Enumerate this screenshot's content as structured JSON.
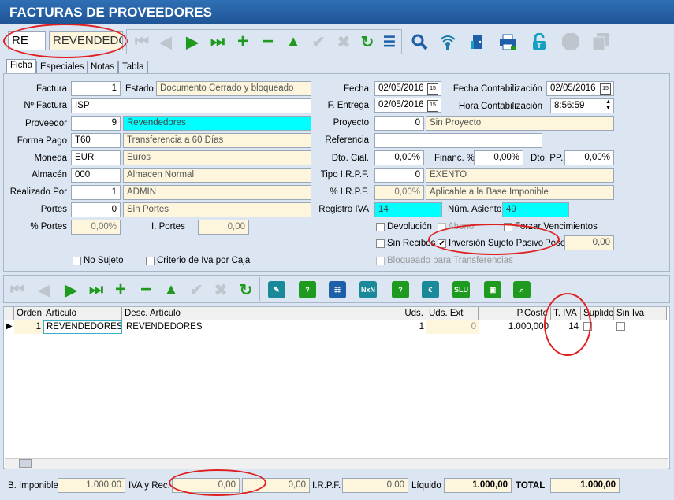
{
  "window": {
    "title": "FACTURAS DE PROVEEDORES"
  },
  "search": {
    "code": "RE",
    "name": "REVENDEDO"
  },
  "tabs": [
    "Ficha",
    "Especiales",
    "Notas",
    "Tabla"
  ],
  "form": {
    "factura_label": "Factura",
    "factura": "1",
    "estado_label": "Estado",
    "estado": "Documento Cerrado y bloqueado",
    "n_factura_label": "Nº Factura",
    "n_factura": "ISP",
    "proveedor_label": "Proveedor",
    "proveedor_code": "9",
    "proveedor_name": "Revendedores",
    "forma_pago_label": "Forma Pago",
    "forma_pago_code": "T60",
    "forma_pago_name": "Transferencia a 60 Días",
    "moneda_label": "Moneda",
    "moneda_code": "EUR",
    "moneda_name": "Euros",
    "almacen_label": "Almacén",
    "almacen_code": "000",
    "almacen_name": "Almacen Normal",
    "realizado_label": "Realizado Por",
    "realizado_code": "1",
    "realizado_name": "ADMIN",
    "portes_label": "Portes",
    "portes_code": "0",
    "portes_name": "Sin Portes",
    "pct_portes_label": "% Portes",
    "pct_portes": "0,00%",
    "i_portes_label": "I. Portes",
    "i_portes": "0,00",
    "fecha_label": "Fecha",
    "fecha": "02/05/2016",
    "fecha_cont_label": "Fecha Contabilización",
    "fecha_cont": "02/05/2016",
    "f_entrega_label": "F. Entrega",
    "f_entrega": "02/05/2016",
    "hora_cont_label": "Hora Contabilización",
    "hora_cont": "8:56:59",
    "proyecto_label": "Proyecto",
    "proyecto_code": "0",
    "proyecto_name": "Sin Proyecto",
    "referencia_label": "Referencia",
    "referencia": "",
    "dto_cial_label": "Dto. Cial.",
    "dto_cial": "0,00%",
    "financ_label": "Financ. %",
    "financ": "0,00%",
    "dto_pp_label": "Dto. PP.",
    "dto_pp": "0,00%",
    "tipo_irpf_label": "Tipo I.R.P.F.",
    "tipo_irpf_code": "0",
    "tipo_irpf_name": "EXENTO",
    "pct_irpf_label": "% I.R.P.F.",
    "pct_irpf": "0,00%",
    "pct_irpf_desc": "Aplicable a la Base Imponible",
    "registro_iva_label": "Registro IVA",
    "registro_iva": "14",
    "num_asiento_label": "Núm. Asiento",
    "num_asiento": "49",
    "devolucion_label": "Devolución",
    "abono_label": "Abono",
    "forzar_label": "Forzar Vencimientos",
    "sin_recibos_label": "Sin Recibos",
    "isp_label": "Inversión Sujeto Pasivo",
    "peso_label": "Peso",
    "peso": "0,00",
    "no_sujeto_label": "No Sujeto",
    "criterio_iva_label": "Criterio de Iva por Caja",
    "bloqueado_label": "Bloqueado para Transferencias"
  },
  "grid": {
    "headers": [
      "Orden",
      "Artículo",
      "Desc. Artículo",
      "Uds.",
      "Uds. Ext",
      "P.Coste",
      "T. IVA",
      "Suplido",
      "Sin Iva"
    ],
    "rows": [
      {
        "orden": "1",
        "articulo": "REVENDEDORES",
        "desc": "REVENDEDORES",
        "uds": "1",
        "uds_ext": "0",
        "p_coste": "1.000,000",
        "t_iva": "14"
      }
    ]
  },
  "totals": {
    "b_imponible_label": "B. Imponible",
    "b_imponible": "1.000,00",
    "iva_rec_label": "IVA y Rec.",
    "iva": "0,00",
    "rec": "0,00",
    "irpf_label": "I.R.P.F.",
    "irpf": "0,00",
    "liquido_label": "Líquido",
    "liquido": "1.000,00",
    "total_label": "TOTAL",
    "total": "1.000,00"
  },
  "colors": {
    "title_bar": "#1f5597",
    "highlight_cyan": "#00ffff",
    "annotation_red": "#e02020",
    "nav_green": "#1e9b1e"
  }
}
